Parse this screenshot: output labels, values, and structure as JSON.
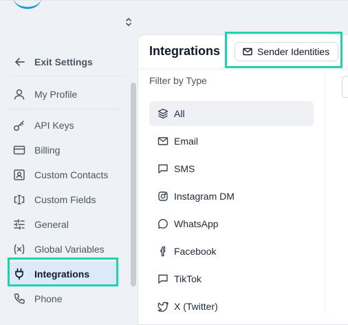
{
  "sidebar": {
    "exit_label": "Exit Settings",
    "items": [
      {
        "label": "My Profile",
        "icon": "user-icon"
      },
      {
        "label": "API Keys",
        "icon": "key-icon"
      },
      {
        "label": "Billing",
        "icon": "credit-card-icon"
      },
      {
        "label": "Custom Contacts",
        "icon": "contact-card-icon"
      },
      {
        "label": "Custom Fields",
        "icon": "text-cursor-icon"
      },
      {
        "label": "General",
        "icon": "sliders-icon"
      },
      {
        "label": "Global Variables",
        "icon": "variable-icon"
      },
      {
        "label": "Integrations",
        "icon": "plug-icon",
        "active": true
      },
      {
        "label": "Phone",
        "icon": "phone-icon"
      }
    ]
  },
  "main": {
    "title": "Integrations",
    "sender_button_label": "Sender Identities",
    "filter_label": "Filter by Type",
    "types": [
      {
        "label": "All",
        "icon": "layers-icon",
        "active": true
      },
      {
        "label": "Email",
        "icon": "mail-icon"
      },
      {
        "label": "SMS",
        "icon": "message-square-icon"
      },
      {
        "label": "Instagram DM",
        "icon": "instagram-icon"
      },
      {
        "label": "WhatsApp",
        "icon": "whatsapp-icon"
      },
      {
        "label": "Facebook",
        "icon": "facebook-icon"
      },
      {
        "label": "TikTok",
        "icon": "message-square-icon"
      },
      {
        "label": "X (Twitter)",
        "icon": "twitter-icon"
      }
    ]
  },
  "colors": {
    "accent_highlight": "#1ed3a8",
    "active_nav_bg": "#dbe9f8",
    "page_bg": "#eef1f6"
  }
}
